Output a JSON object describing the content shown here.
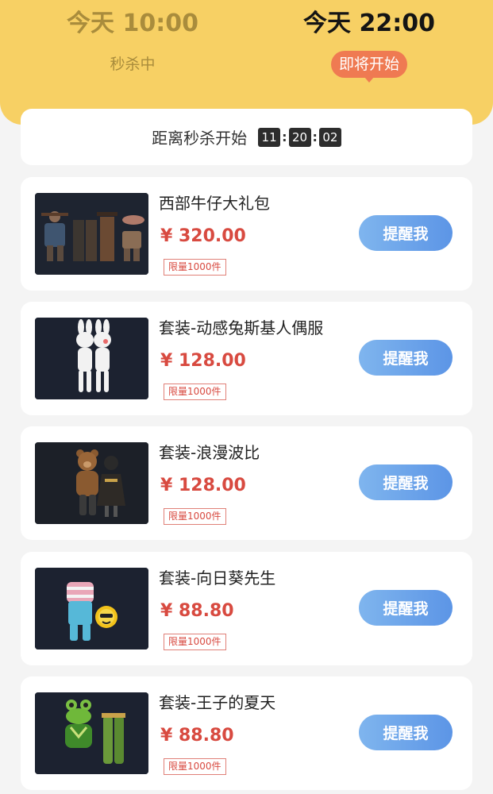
{
  "header": {
    "slots": [
      {
        "time": "今天 10:00",
        "status": "秒杀中",
        "active": false
      },
      {
        "time": "今天 22:00",
        "status": "即将开始",
        "active": true
      }
    ]
  },
  "countdown": {
    "label": "距离秒杀开始",
    "hours": "11",
    "minutes": "20",
    "seconds": "02",
    "separator": ":"
  },
  "colors": {
    "header_bg": "#f7d064",
    "price": "#d84a40",
    "badge": "#ef7a52",
    "button": "#6da5ea"
  },
  "products": [
    {
      "name": "西部牛仔大礼包",
      "price": "¥ 320.00",
      "limit": "限量1000件",
      "button": "提醒我",
      "icon": "cowboy-outfits-image"
    },
    {
      "name": "套装-动感兔斯基人偶服",
      "price": "¥ 128.00",
      "limit": "限量1000件",
      "button": "提醒我",
      "icon": "rabbit-costume-image"
    },
    {
      "name": "套装-浪漫波比",
      "price": "¥ 128.00",
      "limit": "限量1000件",
      "button": "提醒我",
      "icon": "bear-couple-image"
    },
    {
      "name": "套装-向日葵先生",
      "price": "¥ 88.80",
      "limit": "限量1000件",
      "button": "提醒我",
      "icon": "sunflower-outfit-image"
    },
    {
      "name": "套装-王子的夏天",
      "price": "¥ 88.80",
      "limit": "限量1000件",
      "button": "提醒我",
      "icon": "frog-prince-image"
    }
  ]
}
